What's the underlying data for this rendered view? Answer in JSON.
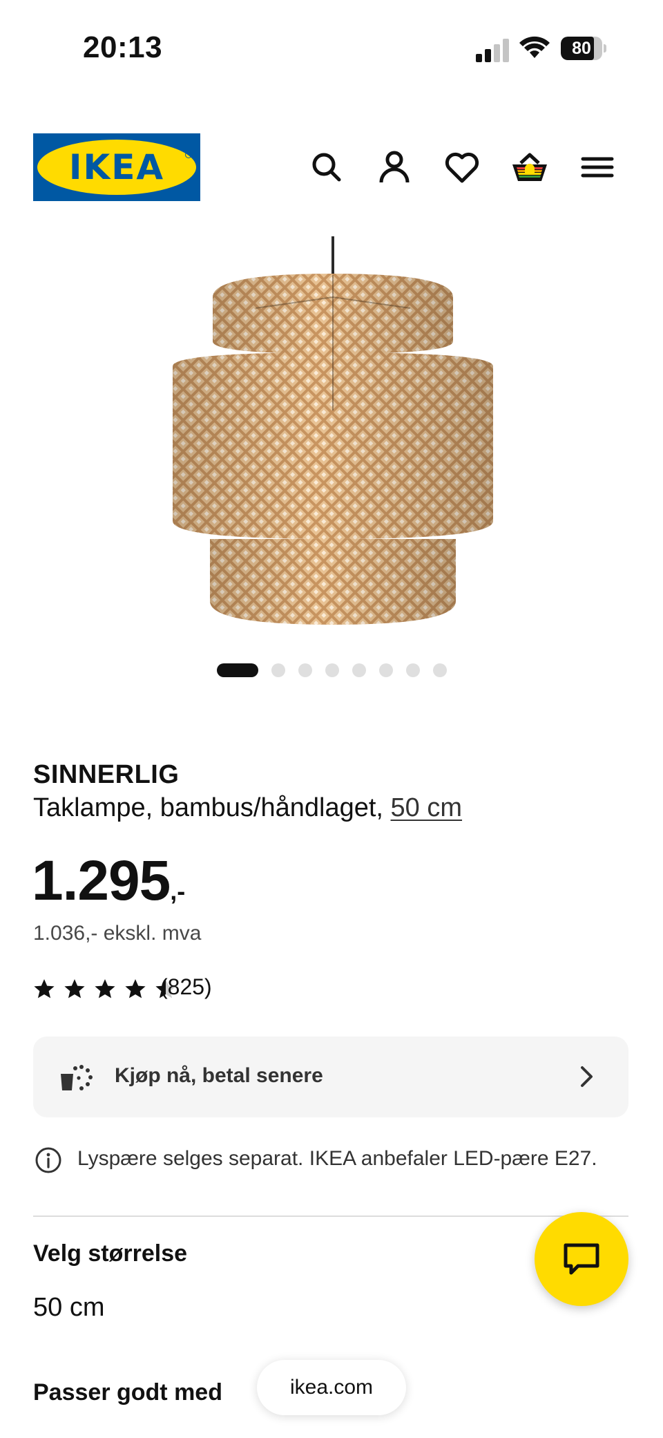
{
  "status_bar": {
    "time": "20:13",
    "battery_percent": "80",
    "battery_level": 0.8,
    "icons": [
      "cellular-signal-icon",
      "wifi-icon",
      "battery-icon"
    ]
  },
  "header": {
    "logo_text": "IKEA",
    "icons": [
      "search-icon",
      "account-icon",
      "heart-icon",
      "shopping-basket-icon",
      "menu-icon"
    ]
  },
  "gallery": {
    "image_count": 8,
    "active_index": 0
  },
  "product": {
    "name": "SINNERLIG",
    "description": "Taklampe, bambus/håndlaget, ",
    "size_link": "50 cm",
    "price_main": "1.295",
    "price_suffix": ",-",
    "price_ex_vat": "1.036,- ekskl. mva",
    "rating_stars": 4.5,
    "rating_count": "(825)"
  },
  "bnpl": {
    "label": "Kjøp nå, betal senere"
  },
  "notice": {
    "text": "Lyspære selges separat. IKEA anbefaler LED-pære E27."
  },
  "size_selector": {
    "heading": "Velg størrelse",
    "selected": "50 cm"
  },
  "related": {
    "heading": "Passer godt med"
  },
  "browser": {
    "url": "ikea.com"
  },
  "colors": {
    "ikea_blue": "#0058a3",
    "ikea_yellow": "#ffdb00",
    "bamboo": "#e3b887"
  }
}
